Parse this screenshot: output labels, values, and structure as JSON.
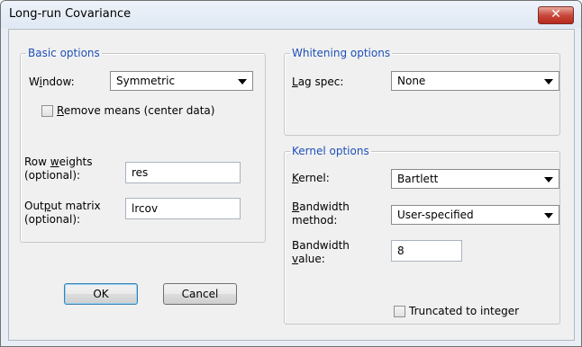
{
  "window": {
    "title": "Long-run Covariance",
    "close_glyph": "✕"
  },
  "basic": {
    "legend": "Basic options",
    "window_label_pre": "W",
    "window_label_ul": "i",
    "window_label_post": "ndow:",
    "window_value": "Symmetric",
    "remove_means_ul": "R",
    "remove_means_post": "emove means (center data)",
    "row_weights_line1_pre": "Row ",
    "row_weights_line1_ul": "w",
    "row_weights_line1_post": "eights",
    "row_weights_line2": "(optional):",
    "row_weights_value": "res",
    "output_line1_pre": "Out",
    "output_line1_ul": "p",
    "output_line1_post": "ut matrix",
    "output_line2": "(optional):",
    "output_value": "lrcov"
  },
  "whitening": {
    "legend": "Whitening options",
    "lag_label_ul": "L",
    "lag_label_post": "ag spec:",
    "lag_value": "None"
  },
  "kernel": {
    "legend": "Kernel options",
    "kernel_label_ul": "K",
    "kernel_label_post": "ernel:",
    "kernel_value": "Bartlett",
    "bw_method_line1_ul": "B",
    "bw_method_line1_post": "andwidth",
    "bw_method_line2": "method:",
    "bw_method_value": "User-specified",
    "bw_value_line1": "Bandwidth",
    "bw_value_line2_ul": "v",
    "bw_value_line2_post": "alue:",
    "bw_value": "8",
    "truncated_label": "Truncated to integer"
  },
  "buttons": {
    "ok": "OK",
    "cancel": "Cancel"
  }
}
